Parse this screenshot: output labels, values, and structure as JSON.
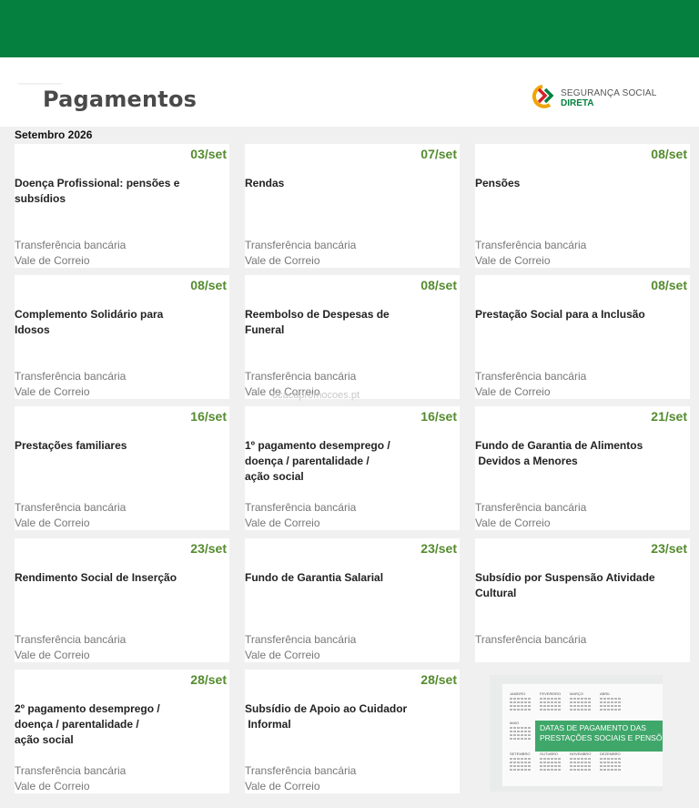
{
  "header": {
    "title": "Pagamentos",
    "brand_line1": "SEGURANÇA SOCIAL",
    "brand_line2": "DIRETA"
  },
  "month": "Setembro 2026",
  "watermark": "ocacapromocoes.pt",
  "cards": [
    {
      "date": "03/set",
      "name": "Doença Profissional: pensões e\nsubsídios",
      "method1": "Transferência bancária",
      "method2": "Vale de Correio"
    },
    {
      "date": "07/set",
      "name": "Rendas",
      "method1": "Transferência bancária",
      "method2": "Vale de Correio"
    },
    {
      "date": "08/set",
      "name": "Pensões",
      "method1": "Transferência bancária",
      "method2": "Vale de Correio"
    },
    {
      "date": "08/set",
      "name": "Complemento Solidário para\nIdosos",
      "method1": "Transferência bancária",
      "method2": "Vale de Correio"
    },
    {
      "date": "08/set",
      "name": "Reembolso de Despesas de\nFuneral",
      "method1": "Transferência bancária",
      "method2": "Vale de Correio"
    },
    {
      "date": "08/set",
      "name": "Prestação Social para a Inclusão",
      "method1": "Transferência bancária",
      "method2": "Vale de Correio"
    },
    {
      "date": "16/set",
      "name": "Prestações familiares",
      "method1": "Transferência bancária",
      "method2": "Vale de Correio"
    },
    {
      "date": "16/set",
      "name": "1º pagamento desemprego /\ndoença / parentalidade /\nação social",
      "method1": "Transferência bancária",
      "method2": "Vale de Correio"
    },
    {
      "date": "21/set",
      "name": "Fundo de Garantia de Alimentos\n Devidos a Menores",
      "method1": "Transferência bancária",
      "method2": "Vale de Correio"
    },
    {
      "date": "23/set",
      "name": "Rendimento Social de Inserção",
      "method1": "Transferência bancária",
      "method2": "Vale de Correio"
    },
    {
      "date": "23/set",
      "name": "Fundo de Garantia Salarial",
      "method1": "Transferência bancária",
      "method2": "Vale de Correio"
    },
    {
      "date": "23/set",
      "name": "Subsídio por Suspensão Atividade\nCultural",
      "method1": "Transferência bancária",
      "method2": ""
    },
    {
      "date": "28/set",
      "name": "2º pagamento desemprego /\ndoença / parentalidade /\nação social",
      "method1": "Transferência bancária",
      "method2": "Vale de Correio"
    },
    {
      "date": "28/set",
      "name": "Subsídio de Apoio ao Cuidador\n Informal",
      "method1": "Transferência bancária",
      "method2": "Vale de Correio"
    }
  ],
  "promo": {
    "banner": "DATAS DE PAGAMENTO DAS\nPRESTAÇÕES SOCIAIS E PENSÕES",
    "months_top": [
      "JANEIRO",
      "FEVEREIRO",
      "MARÇO",
      "ABRIL"
    ],
    "months_mid": [
      "MAIO",
      "",
      "",
      ""
    ],
    "months_bot": [
      "SETEMBRO",
      "OUTUBRO",
      "NOVEMBRO",
      "DEZEMBRO"
    ]
  },
  "colors": {
    "topbar": "#05803f",
    "date": "#558b2f",
    "background": "#f0f0f0"
  }
}
